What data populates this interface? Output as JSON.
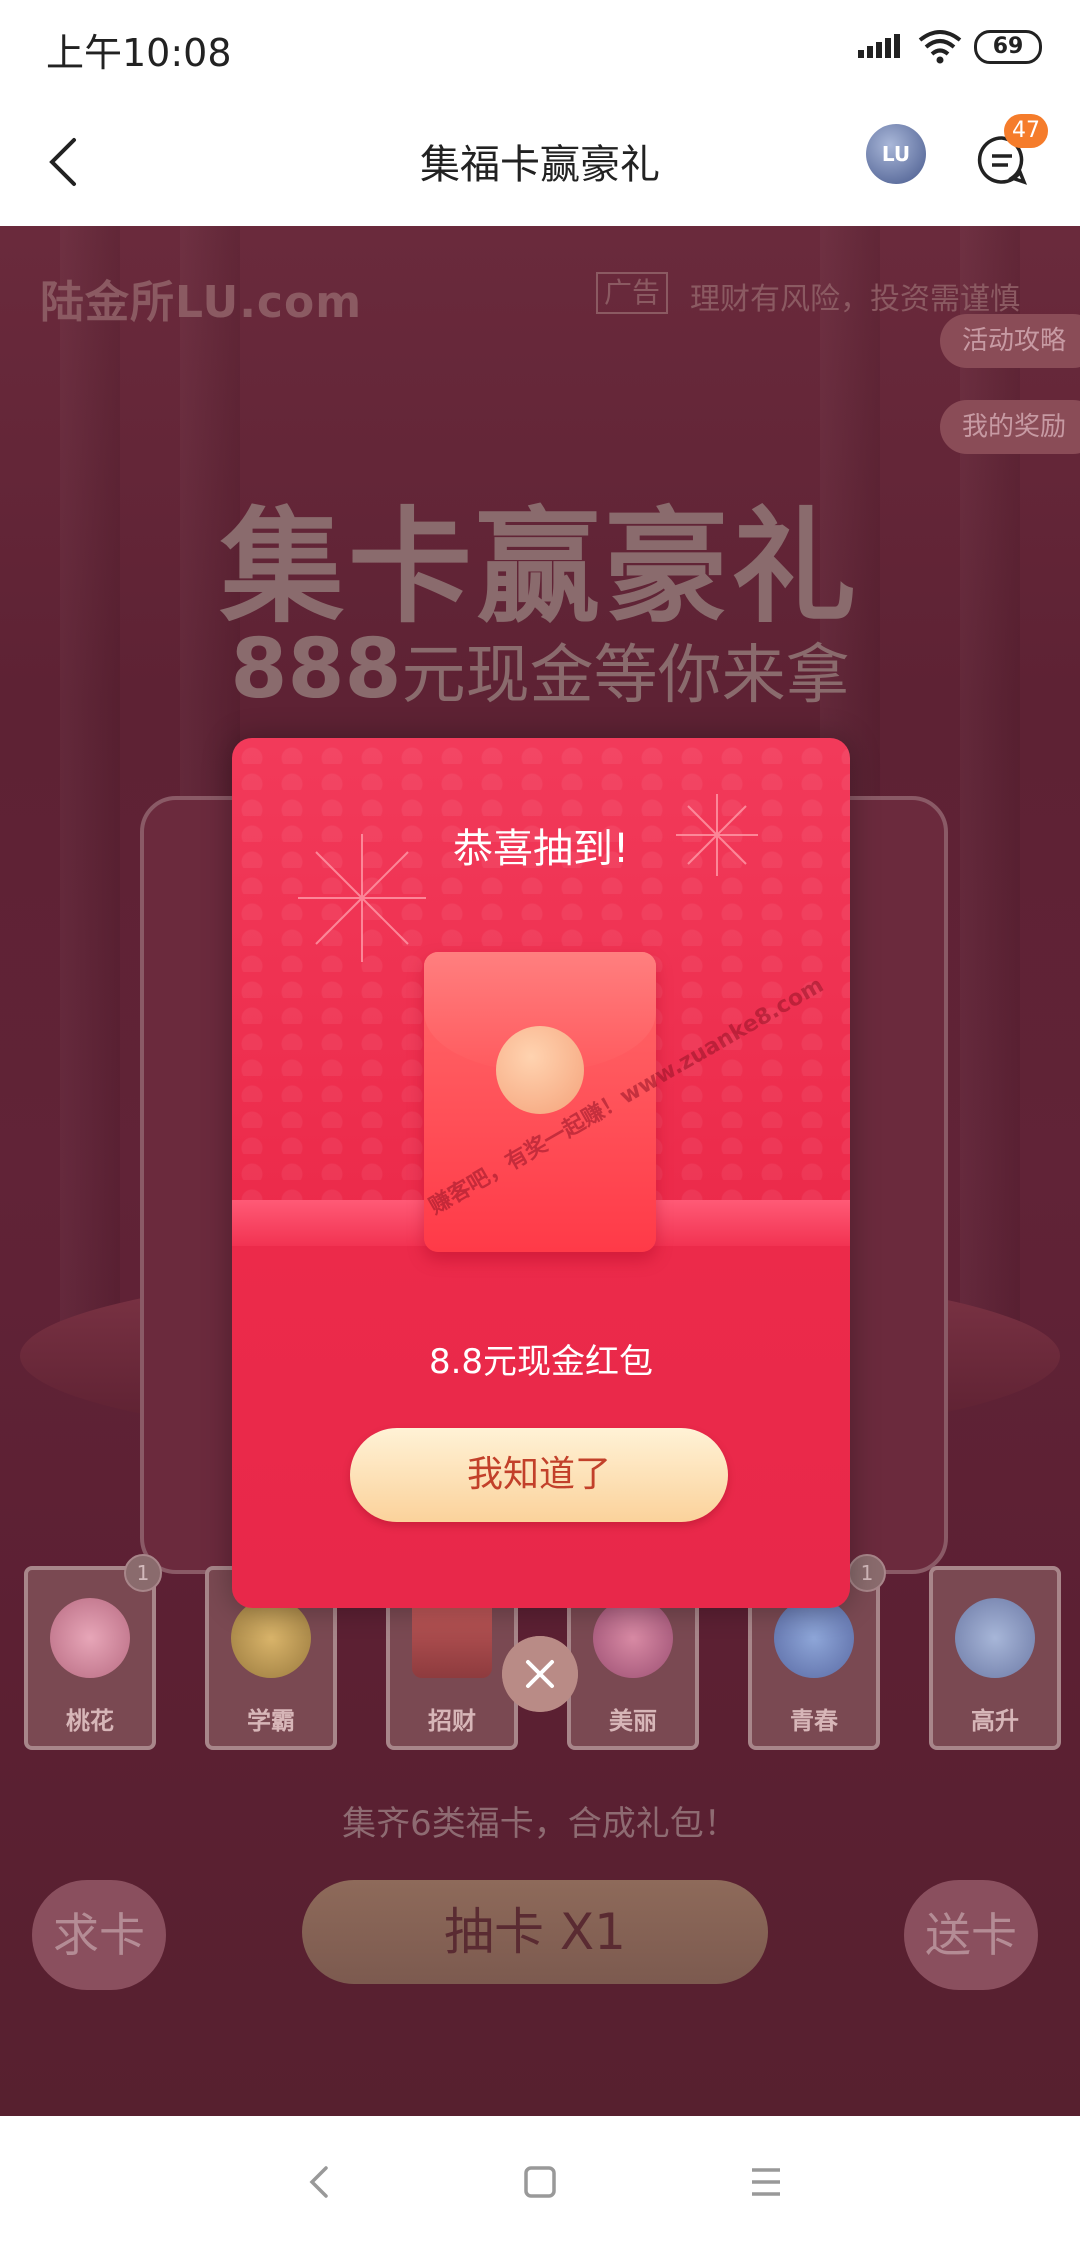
{
  "status_bar": {
    "time": "上午10:08",
    "battery": "69"
  },
  "header": {
    "title": "集福卡赢豪礼",
    "lu_label": "LU",
    "message_badge": "47"
  },
  "background": {
    "logo": "陆金所LU.com",
    "ad_tag": "广告",
    "risk_note": "理财有风险，投资需谨慎",
    "side_buttons": [
      "活动攻略",
      "我的奖励"
    ],
    "headline": "集卡赢豪礼",
    "sub_amount": "888",
    "sub_text": "元现金等你来拿",
    "cards": [
      {
        "label": "桃花",
        "badge": "1"
      },
      {
        "label": "学霸",
        "badge": ""
      },
      {
        "label": "招财",
        "badge": ""
      },
      {
        "label": "美丽",
        "badge": ""
      },
      {
        "label": "青春",
        "badge": "1"
      },
      {
        "label": "高升",
        "badge": ""
      }
    ],
    "collect_tip": "集齐6类福卡，合成礼包！",
    "ask_card": "求卡",
    "draw_card": "抽卡 X1",
    "send_card": "送卡"
  },
  "modal": {
    "title": "恭喜抽到!",
    "watermark": "赚客吧，有奖一起赚！www.zuanke8.com",
    "prize": "8.8元现金红包",
    "confirm": "我知道了"
  },
  "colors": {
    "modal_red": "#ec2a4a",
    "button_gold": "#fbd29b",
    "badge_orange": "#f57c2b"
  },
  "icons": [
    "back-arrow-icon",
    "lu-logo-icon",
    "message-icon",
    "close-icon",
    "signal-icon",
    "wifi-icon",
    "nav-back-icon",
    "nav-home-icon",
    "nav-menu-icon"
  ]
}
